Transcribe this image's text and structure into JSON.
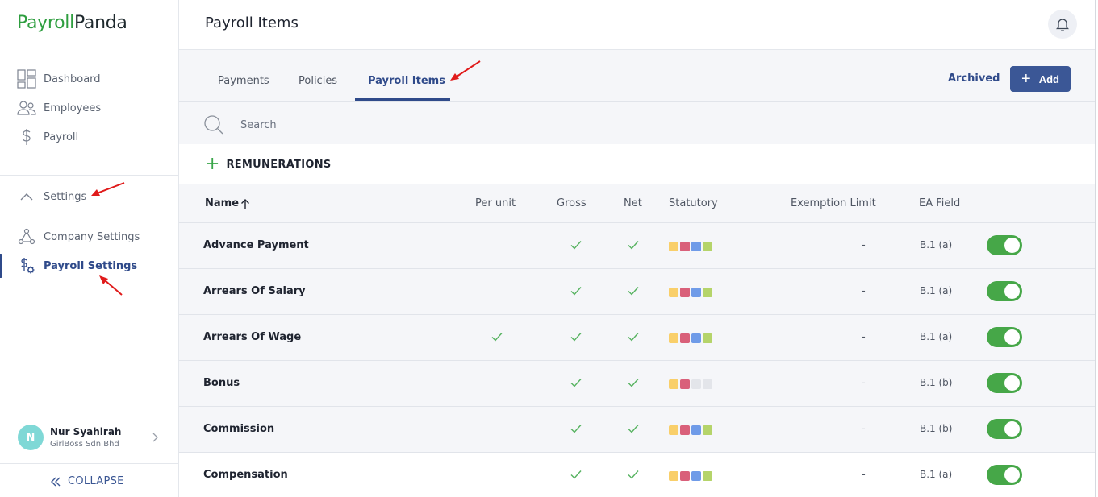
{
  "logo": {
    "part1": "Payroll",
    "part2": "Panda"
  },
  "nav": {
    "dashboard": "Dashboard",
    "employees": "Employees",
    "payroll": "Payroll",
    "settings": "Settings",
    "company_settings": "Company Settings",
    "payroll_settings": "Payroll Settings"
  },
  "user": {
    "initial": "N",
    "name": "Nur Syahirah",
    "company": "GirlBoss Sdn Bhd"
  },
  "collapse": "COLLAPSE",
  "header": {
    "title": "Payroll Items"
  },
  "tabs": [
    "Payments",
    "Policies",
    "Payroll Items"
  ],
  "actions": {
    "archived": "Archived",
    "add": "Add"
  },
  "search": {
    "placeholder": "Search"
  },
  "section": {
    "label": "REMUNERATIONS"
  },
  "columns": {
    "name": "Name",
    "per_unit": "Per unit",
    "gross": "Gross",
    "net": "Net",
    "statutory": "Statutory",
    "exemption": "Exemption Limit",
    "ea_field": "EA Field"
  },
  "statutory_colors": [
    "#f9cf6a",
    "#d9607a",
    "#6f9be8",
    "#b5d46a"
  ],
  "statutory_off_color": "#e3e5ea",
  "check_color": "#55b25f",
  "toggle_color": "#46a748",
  "rows": [
    {
      "name": "Advance Payment",
      "per_unit": false,
      "gross": true,
      "net": true,
      "statutory": [
        true,
        true,
        true,
        true
      ],
      "exemption": "-",
      "ea": "B.1 (a)",
      "enabled": true
    },
    {
      "name": "Arrears Of Salary",
      "per_unit": false,
      "gross": true,
      "net": true,
      "statutory": [
        true,
        true,
        true,
        true
      ],
      "exemption": "-",
      "ea": "B.1 (a)",
      "enabled": true
    },
    {
      "name": "Arrears Of Wage",
      "per_unit": true,
      "gross": true,
      "net": true,
      "statutory": [
        true,
        true,
        true,
        true
      ],
      "exemption": "-",
      "ea": "B.1 (a)",
      "enabled": true
    },
    {
      "name": "Bonus",
      "per_unit": false,
      "gross": true,
      "net": true,
      "statutory": [
        true,
        true,
        false,
        false
      ],
      "exemption": "-",
      "ea": "B.1 (b)",
      "enabled": true
    },
    {
      "name": "Commission",
      "per_unit": false,
      "gross": true,
      "net": true,
      "statutory": [
        true,
        true,
        true,
        true
      ],
      "exemption": "-",
      "ea": "B.1 (b)",
      "enabled": true
    },
    {
      "name": "Compensation",
      "per_unit": false,
      "gross": true,
      "net": true,
      "statutory": [
        true,
        true,
        true,
        true
      ],
      "exemption": "-",
      "ea": "B.1 (a)",
      "enabled": true
    }
  ]
}
